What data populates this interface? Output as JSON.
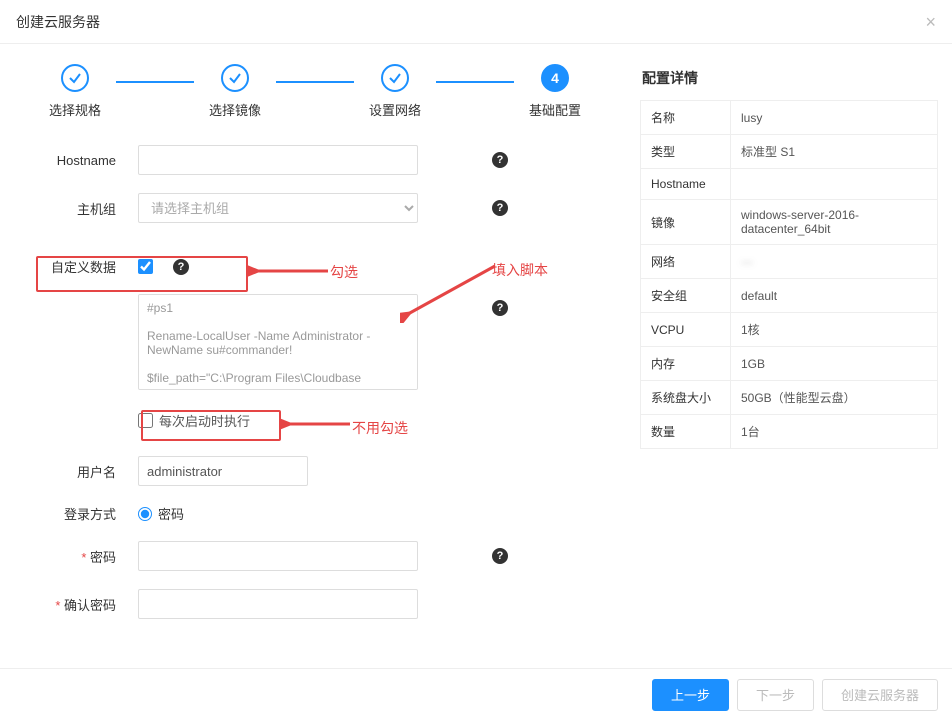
{
  "modal": {
    "title": "创建云服务器"
  },
  "steps": [
    {
      "label": "选择规格",
      "done": true
    },
    {
      "label": "选择镜像",
      "done": true
    },
    {
      "label": "设置网络",
      "done": true
    },
    {
      "label": "基础配置",
      "number": "4",
      "current": true
    }
  ],
  "form": {
    "hostname_label": "Hostname",
    "hostname_value": "",
    "hostgroup_label": "主机组",
    "hostgroup_placeholder": "请选择主机组",
    "customdata_label": "自定义数据",
    "customdata_checked": true,
    "script_text": "#ps1\n\nRename-LocalUser -Name Administrator -NewName su#commander!\n\n$file_path=\"C:\\Program Files\\Cloudbase",
    "run_on_boot_label": "每次启动时执行",
    "run_on_boot_checked": false,
    "username_label": "用户名",
    "username_value": "administrator",
    "login_method_label": "登录方式",
    "login_method_option": "密码",
    "password_label": "密码",
    "confirm_password_label": "确认密码"
  },
  "annotations": {
    "check": "勾选",
    "script": "填入脚本",
    "no_check": "不用勾选"
  },
  "details": {
    "title": "配置详情",
    "rows": [
      {
        "k": "名称",
        "v": "lusy"
      },
      {
        "k": "类型",
        "v": "标准型 S1"
      },
      {
        "k": "Hostname",
        "v": ""
      },
      {
        "k": "镜像",
        "v": "windows-server-2016-datacenter_64bit"
      },
      {
        "k": "网络",
        "v": "···",
        "blur": true
      },
      {
        "k": "安全组",
        "v": "default"
      },
      {
        "k": "VCPU",
        "v": "1核"
      },
      {
        "k": "内存",
        "v": "1GB"
      },
      {
        "k": "系统盘大小",
        "v": "50GB（性能型云盘）"
      },
      {
        "k": "数量",
        "v": "1台"
      }
    ]
  },
  "footer": {
    "prev": "上一步",
    "next": "下一步",
    "create": "创建云服务器"
  }
}
